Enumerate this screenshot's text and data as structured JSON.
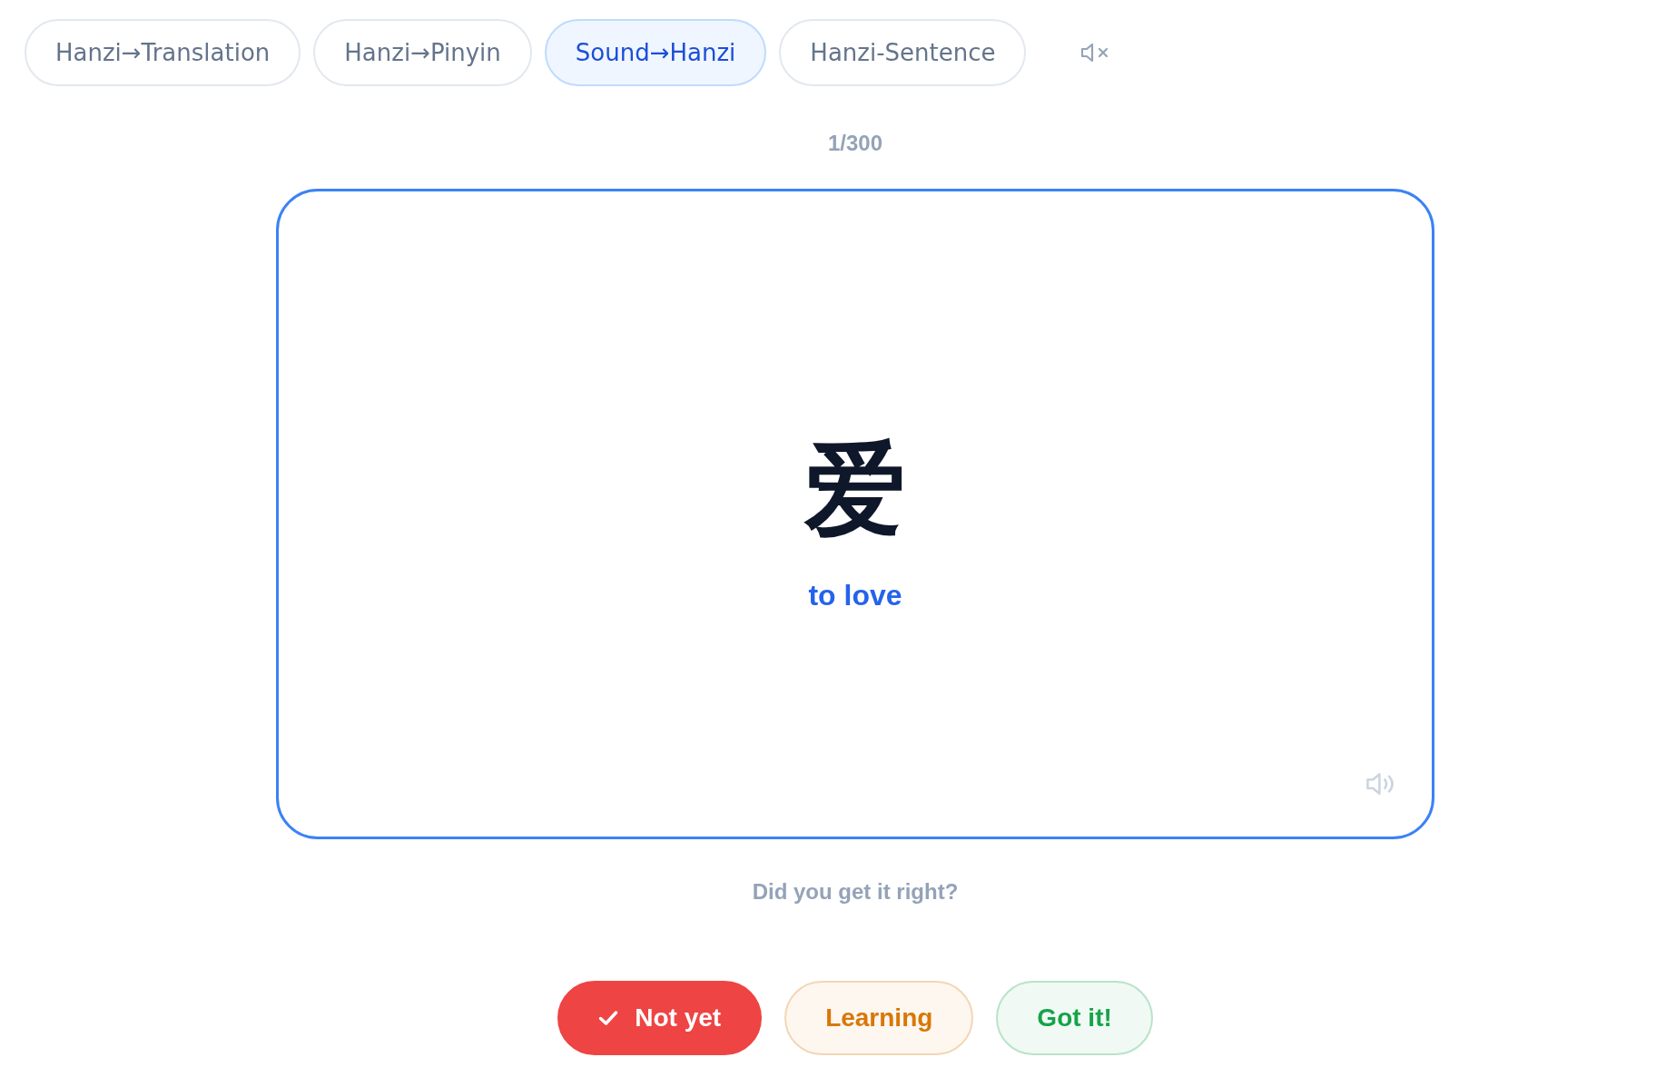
{
  "modes": [
    {
      "label": "Hanzi→Translation",
      "selected": false
    },
    {
      "label": "Hanzi→Pinyin",
      "selected": false
    },
    {
      "label": "Sound→Hanzi",
      "selected": true
    },
    {
      "label": "Hanzi-Sentence",
      "selected": false
    }
  ],
  "sound": {
    "muted": true
  },
  "counter": "1/300",
  "card": {
    "hanzi": "爱",
    "translation": "to love"
  },
  "prompt": "Did you get it right?",
  "ratings": [
    {
      "label": "Not yet",
      "selected": true,
      "color": "#ef4444"
    },
    {
      "label": "Learning",
      "selected": false,
      "color": "#d97706"
    },
    {
      "label": "Got it!",
      "selected": false,
      "color": "#16a34a"
    }
  ]
}
